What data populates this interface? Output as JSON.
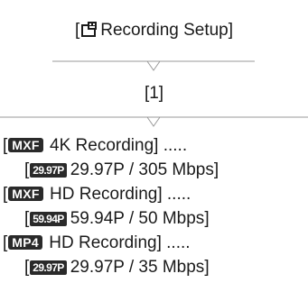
{
  "menu_path": {
    "item1_label": "Recording Setup",
    "item2_label": "[1]"
  },
  "settings": [
    {
      "badge": "MXF",
      "title": "4K Recording",
      "fps_badge": "29.97P",
      "value": "29.97P / 305 Mbps"
    },
    {
      "badge": "MXF",
      "title": "HD Recording",
      "fps_badge": "59.94P",
      "value": "59.94P / 50 Mbps"
    },
    {
      "badge": "MP4",
      "title": "HD Recording",
      "fps_badge": "29.97P",
      "value": "29.97P / 35 Mbps"
    }
  ],
  "dots": ".....",
  "icons": {
    "menu_icon": "camera-setup-icon"
  },
  "colors": {
    "text": "#1a1a1a",
    "badge_bg": "#2a2a2a",
    "separator": "#9a9a9a"
  }
}
